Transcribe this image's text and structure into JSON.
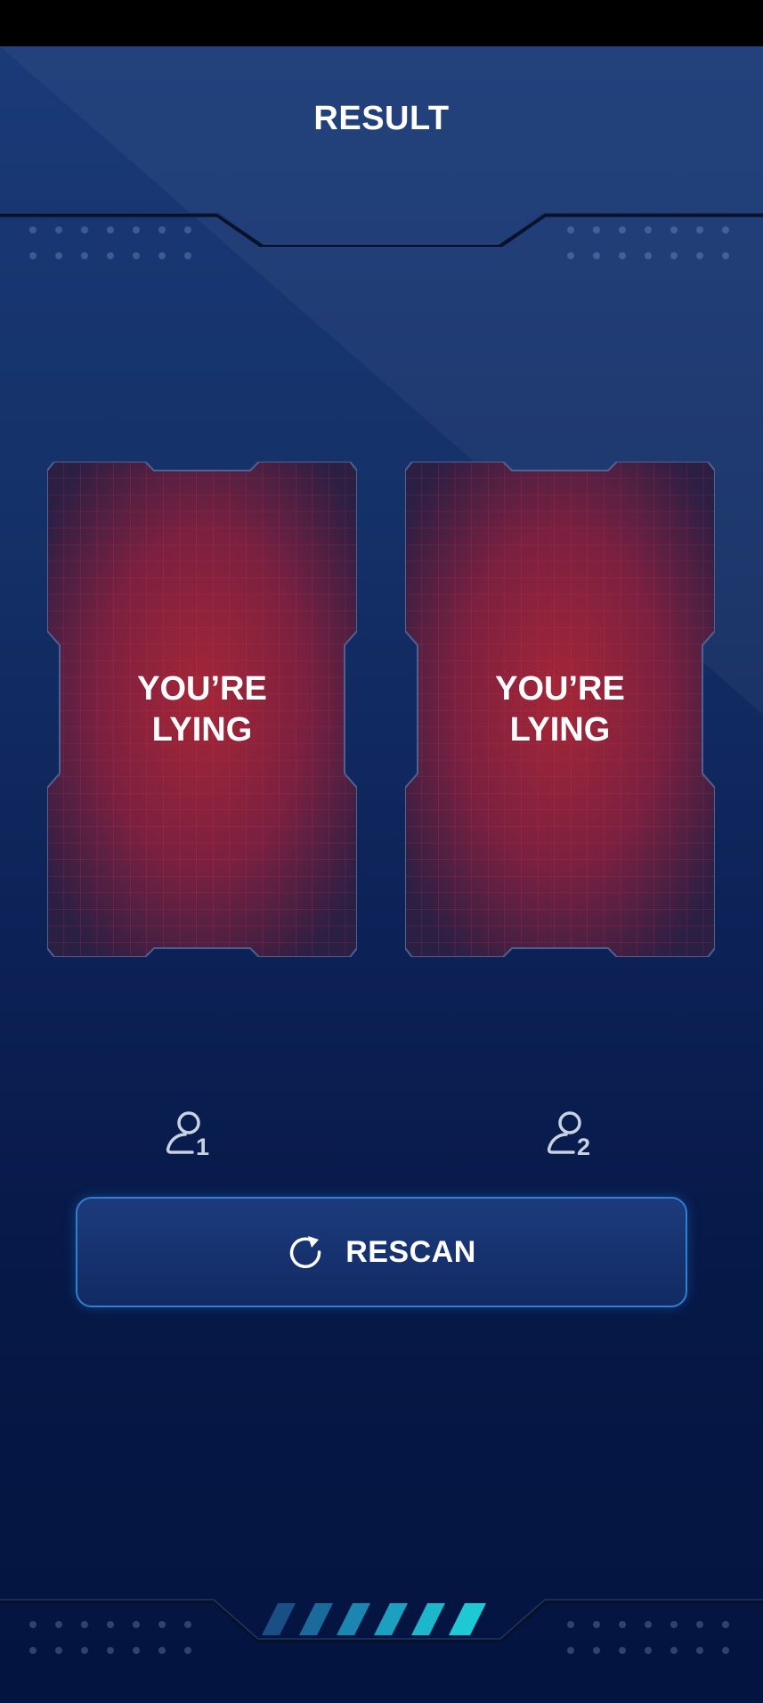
{
  "header": {
    "title": "RESULT"
  },
  "cards": [
    {
      "line1": "YOU’RE",
      "line2": "LYING"
    },
    {
      "line1": "YOU’RE",
      "line2": "LYING"
    }
  ],
  "users": [
    {
      "number": "1",
      "icon": "user-icon"
    },
    {
      "number": "2",
      "icon": "user-icon"
    }
  ],
  "rescan_button": {
    "label": "RESCAN",
    "icon": "refresh-icon"
  },
  "colors": {
    "background": "#0c2156",
    "card_fill": "#8c2236",
    "accent": "#2f7fd2",
    "stripe": "#1ec9d6"
  }
}
